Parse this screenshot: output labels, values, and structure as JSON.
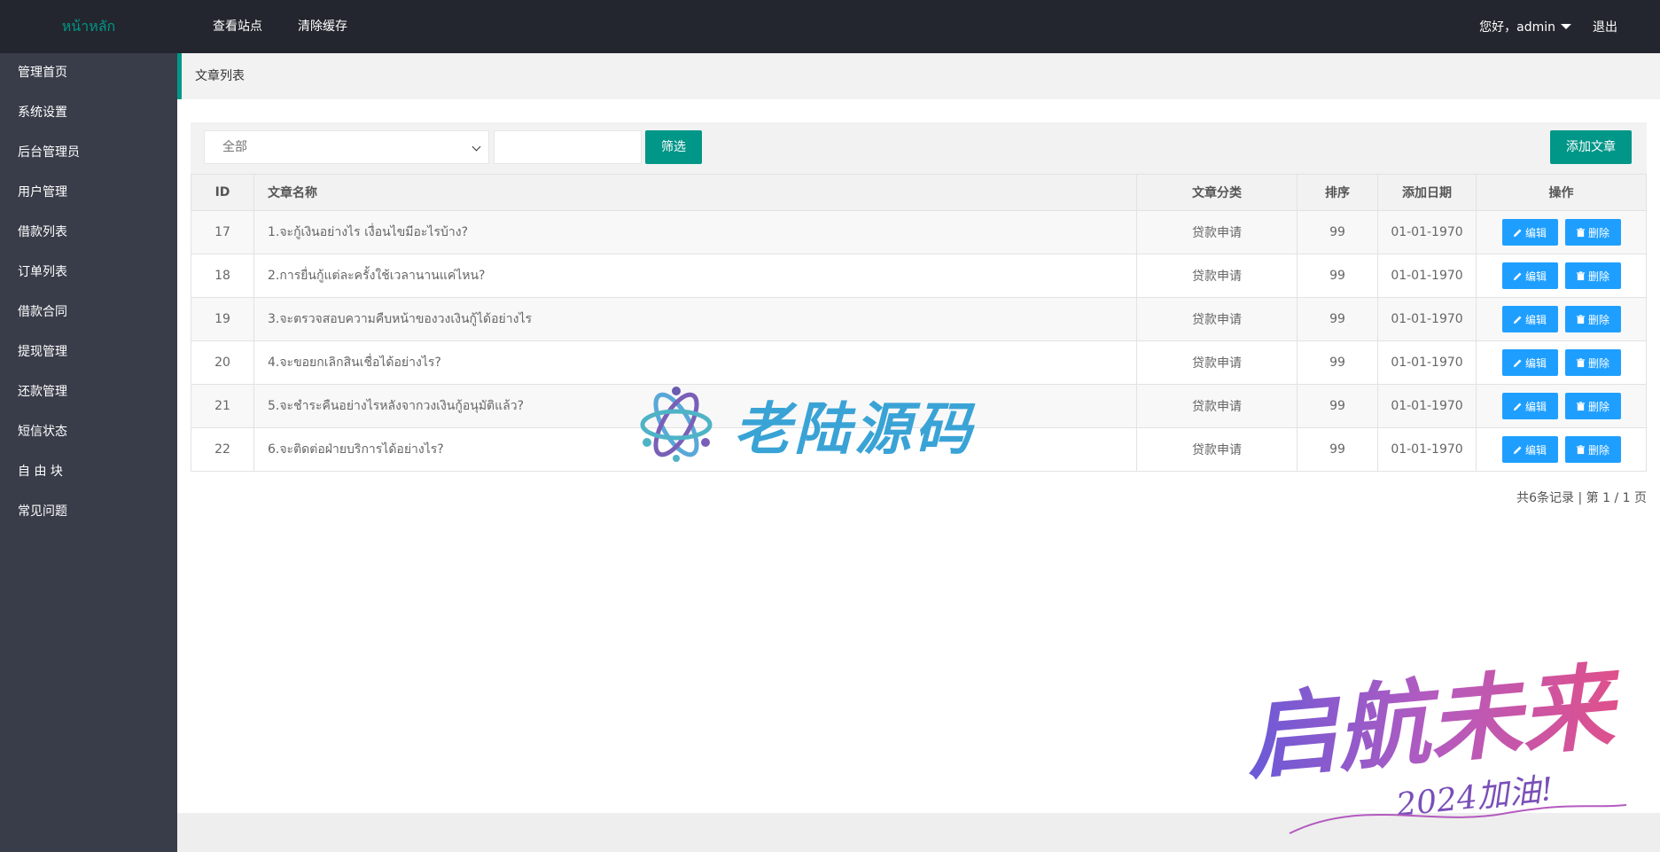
{
  "header": {
    "logo": "หน้าหลัก",
    "nav": [
      "查看站点",
      "清除缓存"
    ],
    "user_greeting": "您好，admin",
    "logout": "退出"
  },
  "sidebar": {
    "items": [
      "管理首页",
      "系统设置",
      "后台管理员",
      "用户管理",
      "借款列表",
      "订单列表",
      "借款合同",
      "提现管理",
      "还款管理",
      "短信状态",
      "自 由 块",
      "常见问题"
    ]
  },
  "breadcrumb": "文章列表",
  "filter": {
    "category_selected": "全部",
    "keyword_value": "",
    "filter_label": "筛选",
    "add_label": "添加文章"
  },
  "table": {
    "headers": [
      "ID",
      "文章名称",
      "文章分类",
      "排序",
      "添加日期",
      "操作"
    ],
    "edit_label": "编辑",
    "delete_label": "删除",
    "rows": [
      {
        "id": "17",
        "title": "1.จะกู้เงินอย่างไร เงื่อนไขมีอะไรบ้าง?",
        "category": "贷款申请",
        "sort": "99",
        "date": "01-01-1970"
      },
      {
        "id": "18",
        "title": "2.การยื่นกู้แต่ละครั้งใช้เวลานานแค่ไหน?",
        "category": "贷款申请",
        "sort": "99",
        "date": "01-01-1970"
      },
      {
        "id": "19",
        "title": "3.จะตรวจสอบความคืบหน้าของวงเงินกู้ได้อย่างไร",
        "category": "贷款申请",
        "sort": "99",
        "date": "01-01-1970"
      },
      {
        "id": "20",
        "title": "4.จะขอยกเลิกสินเชื่อได้อย่างไร?",
        "category": "贷款申请",
        "sort": "99",
        "date": "01-01-1970"
      },
      {
        "id": "21",
        "title": "5.จะชำระคืนอย่างไรหลังจากวงเงินกู้อนุมัติแล้ว?",
        "category": "贷款申请",
        "sort": "99",
        "date": "01-01-1970"
      },
      {
        "id": "22",
        "title": "6.จะติดต่อฝ่ายบริการได้อย่างไร?",
        "category": "贷款申请",
        "sort": "99",
        "date": "01-01-1970"
      }
    ]
  },
  "pagination": "共6条记录 | 第 1 / 1 页",
  "watermarks": {
    "center": "老陆源码",
    "corner": "启航未来",
    "corner_sub": "2024加油!"
  },
  "colors": {
    "accent": "#009688",
    "button_blue": "#1e9fff",
    "topbar": "#23262e",
    "sidebar": "#393d49"
  }
}
